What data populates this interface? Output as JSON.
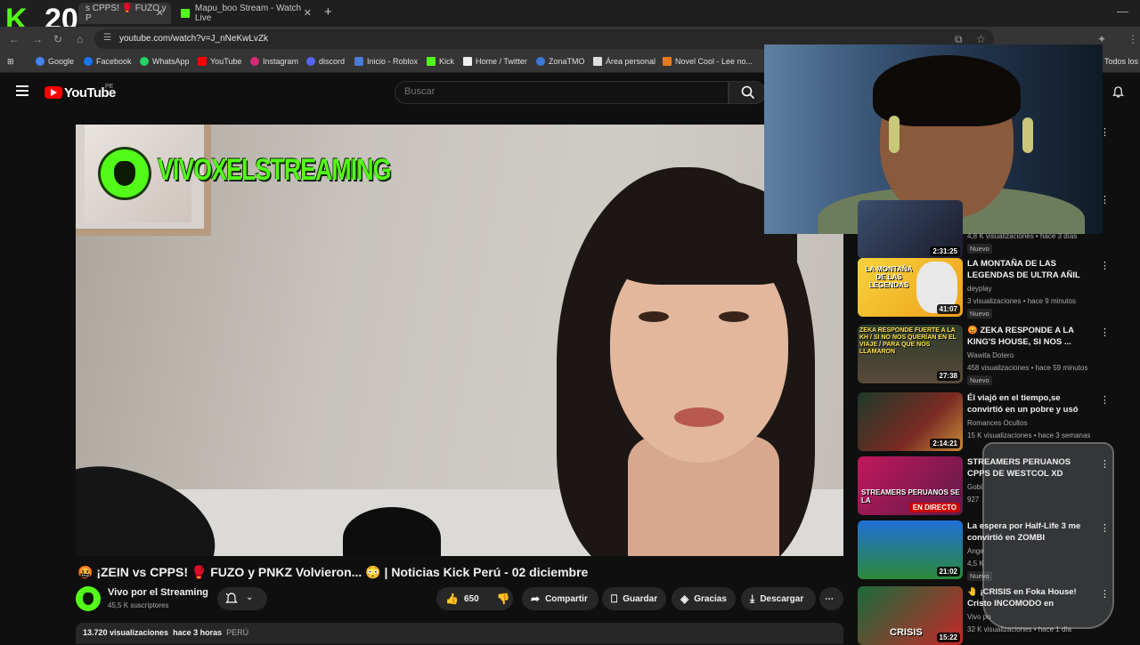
{
  "browser": {
    "kick_logo": "K",
    "kick_count": "20",
    "tabs": [
      {
        "label": "s CPPS! 🥊 FUZO y P"
      },
      {
        "label": "Mapu_boo Stream - Watch Live"
      }
    ],
    "new_tab": "+",
    "url": "youtube.com/watch?v=J_nNeKwLvZk",
    "bookmarks": [
      "Google",
      "Facebook",
      "WhatsApp",
      "YouTube",
      "Instagram",
      "discord",
      "Inicio - Roblox",
      "Kick",
      "Home / Twitter",
      "ZonaTMO",
      "Área personal",
      "Novel Cool - Lee no...",
      "Todos los"
    ]
  },
  "header": {
    "logo_text": "YouTube",
    "country": "PE",
    "search_placeholder": "Buscar"
  },
  "video": {
    "watermark": "VIVOXELSTREAMING",
    "title": "🤬 ¡ZEIN vs CPPS! 🥊 FUZO y PNKZ Volvieron... 😳 | Noticias Kick Perú - 02 diciembre",
    "channel": "Vivo por el Streaming",
    "subscribers": "45,5 K suscriptores",
    "likes": "650",
    "share": "Compartir",
    "save": "Guardar",
    "thanks": "Gracias",
    "download": "Descargar",
    "more": "⋯",
    "views": "13.720 visualizaciones",
    "age": "hace 3 horas",
    "country": "PERÚ"
  },
  "sidebar": [
    {
      "title": "",
      "channel": "",
      "meta": "4,8 K visualizaciones • hace 3 días",
      "duration": "2:31:25",
      "badge": "Nuevo"
    },
    {
      "title": "LA MONTAÑA DE LAS LEGENDAS DE ULTRA AÑIL ...",
      "channel": "deyplay",
      "meta": "3 visualizaciones • hace 9 minutos",
      "duration": "41:07",
      "badge": "Nuevo",
      "thumb_text": "LA MONTAÑA DE LAS LEGENDAS"
    },
    {
      "title": "😡 ZEKA RESPONDE A LA KING'S HOUSE, SI NOS ...",
      "channel": "Wawita Dotero",
      "meta": "458 visualizaciones • hace 59 minutos",
      "duration": "27:38",
      "badge": "Nuevo",
      "thumb_text": "ZEKA RESPONDE FUERTE A LA KH / SI NO NOS QUERÍAN EN EL VIAJE / PARA QUE NOS LLAMARON"
    },
    {
      "title": "Él viajó en el tiempo,se convirtió en un pobre y usó su ...",
      "channel": "Romances Ocultos",
      "meta": "15 K visualizaciones • hace 3 semanas",
      "duration": "2:14:21",
      "badge": ""
    },
    {
      "title": "STREAMERS PERUANOS CPPS DE WESTCOL XD #peru",
      "channel": "Gobi",
      "meta": "927",
      "duration": "",
      "badge": "",
      "live": "EN DIRECTO",
      "thumb_text": "STREAMERS PERUANOS SE LA"
    },
    {
      "title": "La espera por Half-Life 3 me convirtió en ZOMBI",
      "channel": "Ange",
      "meta": "4,5 K",
      "duration": "21:02",
      "badge": "Nuevo"
    },
    {
      "title": "🤚 ¡CRISIS en Foka House! Cristo INCOMODO en ESPAÑA ...",
      "channel": "Vivo po",
      "meta": "32 K visualizaciones • hace 1 día",
      "duration": "15:22",
      "badge": "",
      "thumb_text": "CRISIS"
    }
  ],
  "colors": {
    "kick_green": "#53fc18",
    "youtube_red": "#ff0000",
    "background": "#0f0f0f"
  },
  "icons": {
    "like": "thumbs-up-icon",
    "dislike": "thumbs-down-icon",
    "share": "share-arrow-icon",
    "save": "bookmark-icon",
    "thanks": "thanks-icon",
    "download": "download-icon"
  }
}
